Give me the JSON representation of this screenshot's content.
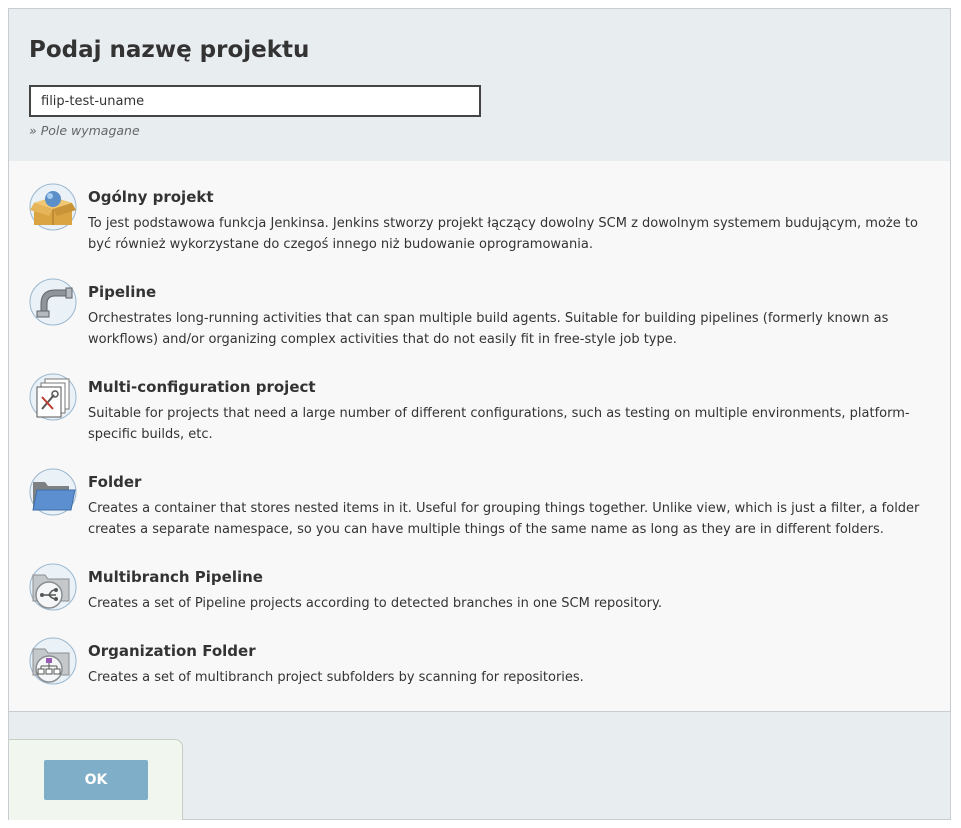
{
  "header": {
    "title": "Podaj nazwę projektu",
    "name_value": "filip-test-uname",
    "required_note": "» Pole wymagane"
  },
  "items": [
    {
      "icon": "freestyle-project-icon",
      "title": "Ogólny projekt",
      "description": "To jest podstawowa funkcja Jenkinsa. Jenkins stworzy projekt łączący dowolny SCM z dowolnym systemem budującym, może to być również wykorzystane do czegoś innego niż budowanie oprogramowania."
    },
    {
      "icon": "pipeline-icon",
      "title": "Pipeline",
      "description": "Orchestrates long-running activities that can span multiple build agents. Suitable for building pipelines (formerly known as workflows) and/or organizing complex activities that do not easily fit in free-style job type."
    },
    {
      "icon": "multi-configuration-icon",
      "title": "Multi-configuration project",
      "description": "Suitable for projects that need a large number of different configurations, such as testing on multiple environments, platform-specific builds, etc."
    },
    {
      "icon": "folder-icon",
      "title": "Folder",
      "description": "Creates a container that stores nested items in it. Useful for grouping things together. Unlike view, which is just a filter, a folder creates a separate namespace, so you can have multiple things of the same name as long as they are in different folders."
    },
    {
      "icon": "multibranch-pipeline-icon",
      "title": "Multibranch Pipeline",
      "description": "Creates a set of Pipeline projects according to detected branches in one SCM repository."
    },
    {
      "icon": "organization-folder-icon",
      "title": "Organization Folder",
      "description": "Creates a set of multibranch project subfolders by scanning for repositories."
    }
  ],
  "footer": {
    "ok_label": "OK"
  },
  "colors": {
    "header_bg": "#e8edf0",
    "list_bg": "#f8f8f8",
    "ok_button": "#7fafc8",
    "footer_bg": "#f1f7ef"
  }
}
